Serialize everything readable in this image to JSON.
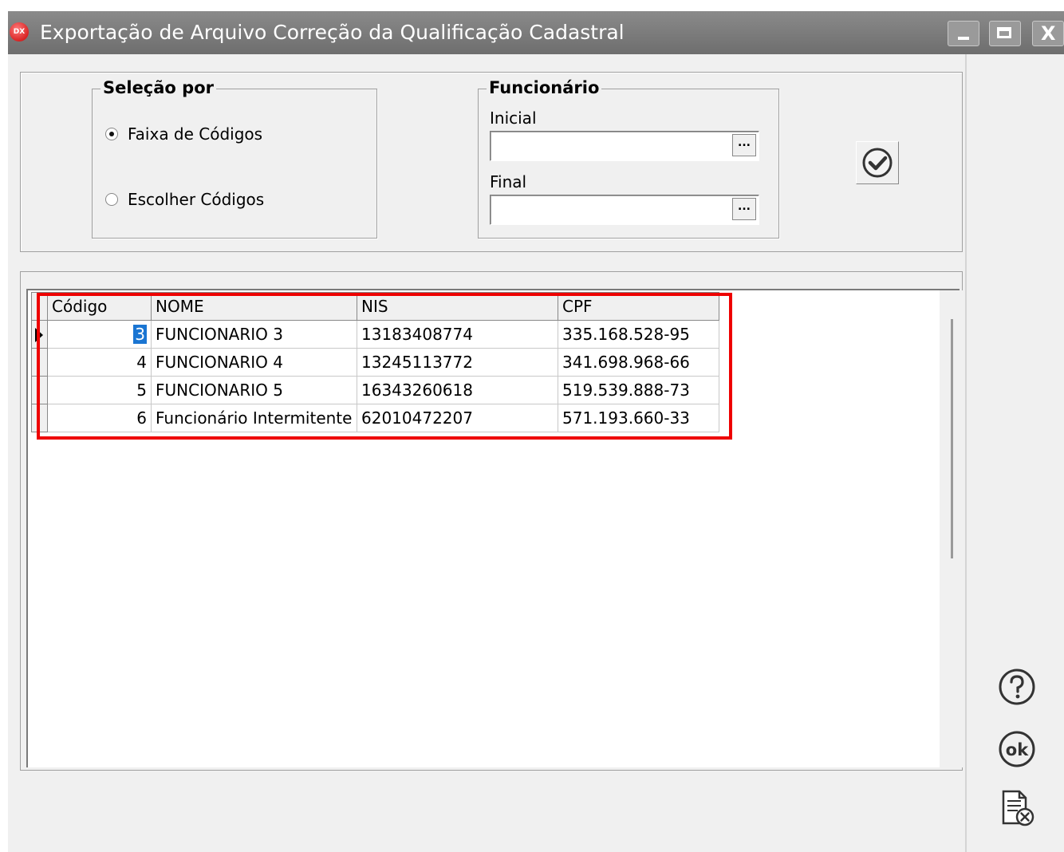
{
  "window": {
    "title": "Exportação de Arquivo Correção da Qualificação Cadastral",
    "app_icon_text": "DX",
    "close_glyph": "X"
  },
  "selecao": {
    "title": "Seleção por",
    "options": [
      {
        "label": "Faixa de Códigos",
        "checked": true
      },
      {
        "label": "Escolher Códigos",
        "checked": false
      }
    ]
  },
  "funcionario": {
    "title": "Funcionário",
    "inicial_label": "Inicial",
    "inicial_value": "",
    "final_label": "Final",
    "final_value": "",
    "ellipsis": "..."
  },
  "grid": {
    "columns": [
      "Código",
      "NOME",
      "NIS",
      "CPF"
    ],
    "rows": [
      {
        "codigo": "3",
        "nome": "FUNCIONARIO 3",
        "nis": "13183408774",
        "cpf": "335.168.528-95"
      },
      {
        "codigo": "4",
        "nome": "FUNCIONARIO 4",
        "nis": "13245113772",
        "cpf": "341.698.968-66"
      },
      {
        "codigo": "5",
        "nome": "FUNCIONARIO 5",
        "nis": "16343260618",
        "cpf": "519.539.888-73"
      },
      {
        "codigo": "6",
        "nome": "Funcionário Intermitente",
        "nis": "62010472207",
        "cpf": "571.193.660-33"
      }
    ]
  },
  "side": {
    "ok_text": "ok"
  },
  "colors": {
    "highlight": "#ee0000",
    "selection": "#1a75d2",
    "titlebar": "#7a7a7a"
  }
}
